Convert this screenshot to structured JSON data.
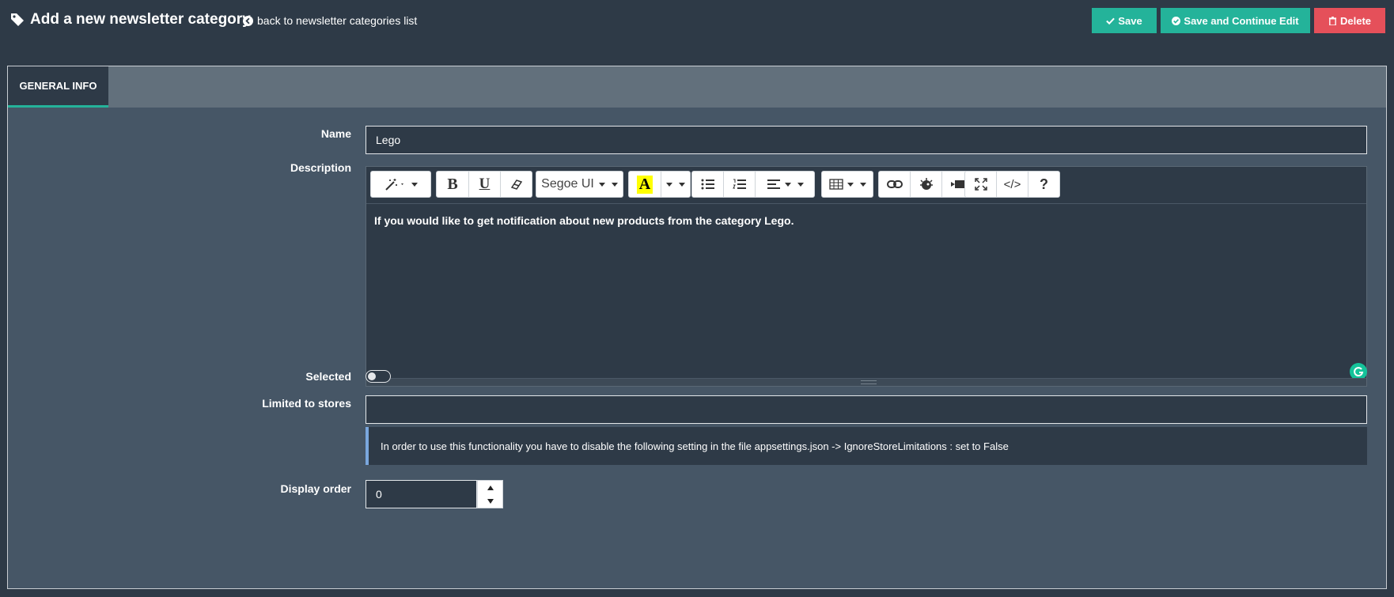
{
  "header": {
    "title": "Add a new newsletter category",
    "back_link": "back to newsletter categories list",
    "buttons": {
      "save": "Save",
      "save_continue": "Save and Continue Edit",
      "delete": "Delete"
    }
  },
  "tabs": [
    {
      "label": "GENERAL INFO",
      "active": true
    }
  ],
  "form": {
    "name": {
      "label": "Name",
      "value": "Lego"
    },
    "description": {
      "label": "Description",
      "content": "If you would like to get notification about new products from the category Lego.",
      "toolbar": {
        "font_name": "Segoe UI",
        "highlight_letter": "A",
        "bold": "B",
        "underline": "U",
        "code_view": "</>",
        "help": "?"
      }
    },
    "selected": {
      "label": "Selected",
      "checked": false
    },
    "limited_to_stores": {
      "label": "Limited to stores",
      "value": "",
      "note": "In order to use this functionality you have to disable the following setting in the file appsettings.json -> IgnoreStoreLimitations : set to False"
    },
    "display_order": {
      "label": "Display order",
      "value": "0"
    }
  },
  "colors": {
    "background": "#2e3a47",
    "panel": "#465666",
    "tabbar": "#62707c",
    "accent": "#24b39a",
    "danger": "#e5505a",
    "note_border": "#7aa6dd"
  },
  "icons": [
    "tag-icon",
    "arrow-circle-left-icon",
    "check-icon",
    "check-circle-icon",
    "trash-icon",
    "magic-icon",
    "eraser-icon",
    "list-ul-icon",
    "list-ol-icon",
    "align-icon",
    "table-icon",
    "link-icon",
    "picture-icon",
    "video-icon",
    "image-icon",
    "fullscreen-icon",
    "help-icon",
    "grammarly-icon"
  ]
}
